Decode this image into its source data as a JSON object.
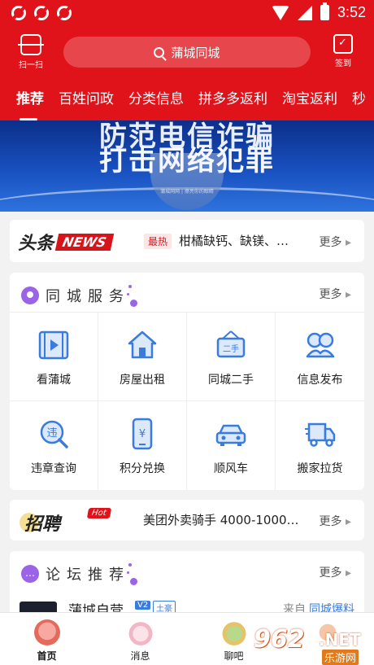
{
  "statusbar": {
    "time": "3:52"
  },
  "header": {
    "scan_label": "扫一扫",
    "search_placeholder": "蒲城同城",
    "checkin_label": "签到"
  },
  "tabs": [
    {
      "label": "推荐",
      "active": true
    },
    {
      "label": "百姓问政"
    },
    {
      "label": "分类信息"
    },
    {
      "label": "拼多多返利"
    },
    {
      "label": "淘宝返利"
    },
    {
      "label": "秒"
    }
  ],
  "banner": {
    "line1": "防范电信诈骗",
    "line2": "打击网络犯罪",
    "small": "蒲城网网 | 擦亮你的眼睛"
  },
  "news": {
    "logo_text": "头条",
    "logo_badge": "NEWS",
    "tag": "最热",
    "headline": "柑橘缺钙、缺镁、…",
    "more": "更多"
  },
  "services": {
    "title": "同城服务",
    "more": "更多",
    "items": [
      {
        "label": "看蒲城",
        "icon": "film-icon"
      },
      {
        "label": "房屋出租",
        "icon": "house-icon"
      },
      {
        "label": "同城二手",
        "icon": "secondhand-sign-icon"
      },
      {
        "label": "信息发布",
        "icon": "people-icon"
      },
      {
        "label": "违章查询",
        "icon": "violation-search-icon"
      },
      {
        "label": "积分兑换",
        "icon": "phone-coin-icon"
      },
      {
        "label": "顺风车",
        "icon": "car-icon"
      },
      {
        "label": "搬家拉货",
        "icon": "truck-icon"
      }
    ]
  },
  "jobs": {
    "logo_text": "招聘",
    "badge": "Hot",
    "headline": "美团外卖骑手 4000-1000…",
    "more": "更多"
  },
  "forum": {
    "title": "论坛推荐",
    "more": "更多",
    "item": {
      "title": "蒲城自营",
      "level": "V2",
      "rank": "土豪",
      "from_label": "来自",
      "from_source": "同城爆料"
    }
  },
  "bottomnav": [
    {
      "label": "首页",
      "icon": "home-pig-icon",
      "active": true
    },
    {
      "label": "消息",
      "icon": "message-bunny-icon"
    },
    {
      "label": "聊吧",
      "icon": "chat-turtle-icon"
    },
    {
      "label": "",
      "icon": "mine-icon"
    }
  ],
  "watermark": {
    "num": "962",
    "net": ".NET",
    "site": "乐游网"
  },
  "colors": {
    "brand_red": "#e0121a",
    "accent_purple": "#9b63e8",
    "icon_blue": "#3a7be0"
  }
}
